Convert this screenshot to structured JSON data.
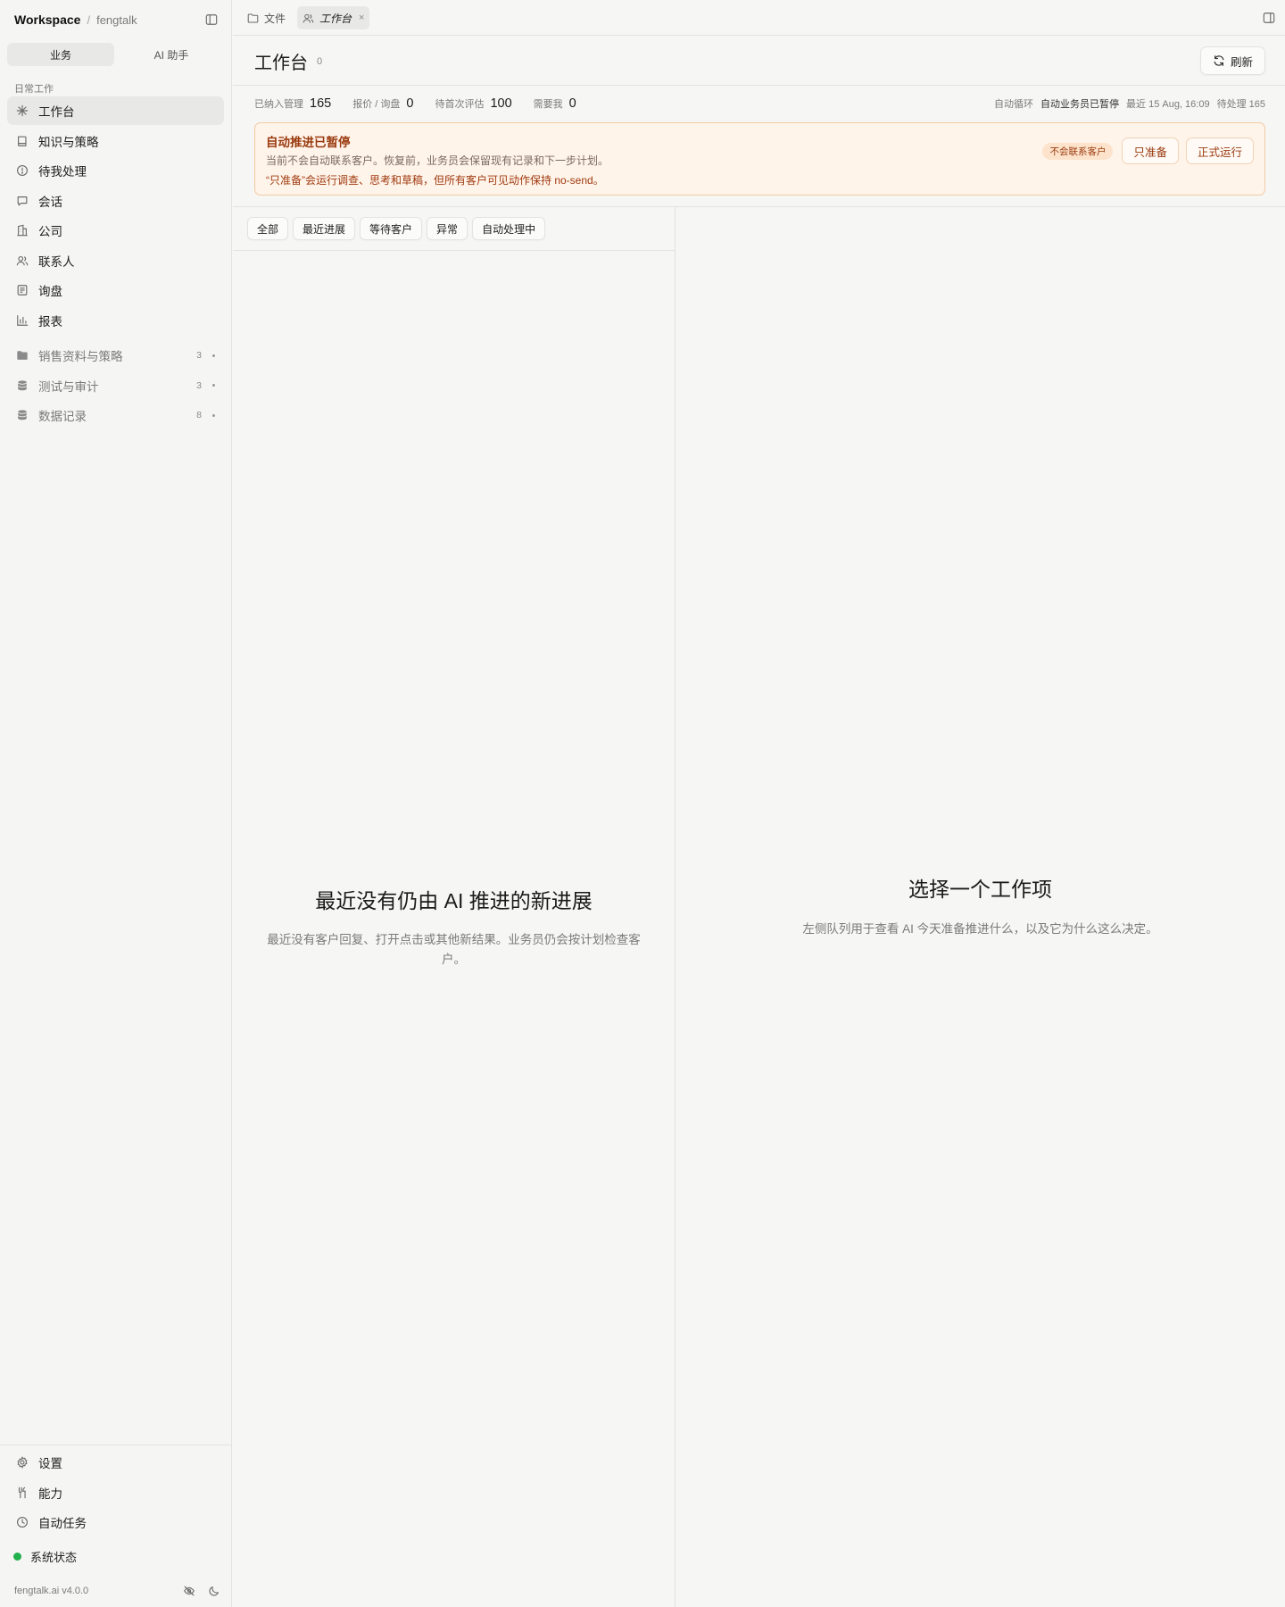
{
  "sidebar": {
    "brand": "Workspace",
    "separator": "/",
    "workspace": "fengtalk",
    "switch": {
      "business": "业务",
      "assistant": "AI 助手"
    },
    "section": "日常工作",
    "items": [
      {
        "label": "工作台"
      },
      {
        "label": "知识与策略"
      },
      {
        "label": "待我处理"
      },
      {
        "label": "会话"
      },
      {
        "label": "公司"
      },
      {
        "label": "联系人"
      },
      {
        "label": "询盘"
      },
      {
        "label": "报表"
      }
    ],
    "groups": [
      {
        "label": "销售资料与策略",
        "count": "3"
      },
      {
        "label": "测试与审计",
        "count": "3"
      },
      {
        "label": "数据记录",
        "count": "8"
      }
    ],
    "bottom": [
      {
        "label": "设置"
      },
      {
        "label": "能力"
      },
      {
        "label": "自动任务"
      }
    ],
    "status": "系统状态",
    "version": "fengtalk.ai v4.0.0"
  },
  "tabs": [
    {
      "label": "文件"
    },
    {
      "label": "工作台",
      "close": "×"
    }
  ],
  "header": {
    "title": "工作台",
    "count": "0",
    "refresh": "刷新"
  },
  "stats": [
    {
      "label": "已纳入管理",
      "value": "165"
    },
    {
      "label": "报价 / 询盘",
      "value": "0"
    },
    {
      "label": "待首次评估",
      "value": "100"
    },
    {
      "label": "需要我",
      "value": "0"
    }
  ],
  "stats_right": {
    "loop_label": "自动循环",
    "loop_state": "自动业务员已暂停",
    "last": "最近 15 Aug, 16:09",
    "pending": "待处理 165"
  },
  "alert": {
    "title": "自动推进已暂停",
    "desc": "当前不会自动联系客户。恢复前，业务员会保留现有记录和下一步计划。",
    "note": "“只准备”会运行调查、思考和草稿，但所有客户可见动作保持 no-send。",
    "badge": "不会联系客户",
    "prepare": "只准备",
    "run": "正式运行"
  },
  "filters": [
    "全部",
    "最近进展",
    "等待客户",
    "异常",
    "自动处理中"
  ],
  "left_empty": {
    "title": "最近没有仍由 AI 推进的新进展",
    "desc": "最近没有客户回复、打开点击或其他新结果。业务员仍会按计划检查客户。"
  },
  "right_empty": {
    "title": "选择一个工作项",
    "desc": "左侧队列用于查看 AI 今天准备推进什么，以及它为什么这么决定。"
  },
  "colors": {
    "status_ok": "#22b14c",
    "alert_bg": "#fff4ea",
    "alert_border": "#f3c9a3",
    "alert_text": "#9a3a0e"
  }
}
